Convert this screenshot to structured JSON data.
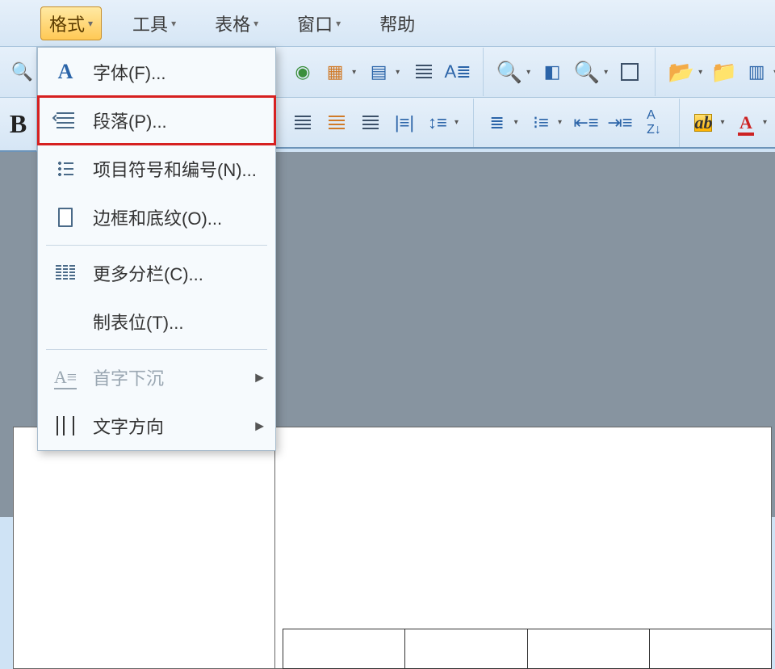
{
  "menubar": {
    "format": "格式",
    "tools": "工具",
    "table": "表格",
    "window": "窗口",
    "help": "帮助"
  },
  "dropdown": {
    "font": "字体(F)...",
    "paragraph": "段落(P)...",
    "bullets": "项目符号和编号(N)...",
    "borders": "边框和底纹(O)...",
    "columns": "更多分栏(C)...",
    "tabs": "制表位(T)...",
    "dropcap": "首字下沉",
    "textdir": "文字方向"
  },
  "bold_label": "B"
}
